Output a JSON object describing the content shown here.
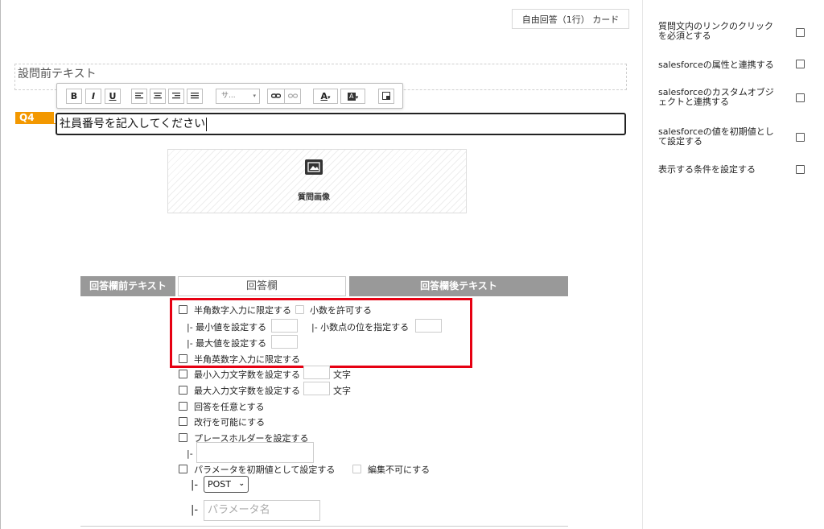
{
  "header": {
    "question_type": "自由回答（1行） カード"
  },
  "editor": {
    "pretext_label": "設問前テキスト",
    "toolbar": {
      "bold": "B",
      "italic": "I",
      "underline": "U",
      "font_size": "サ..."
    },
    "question_number": "Q4",
    "question_text": "社員番号を記入してください",
    "image_label": "質問画像"
  },
  "answer": {
    "pre_text_label": "回答欄前テキスト",
    "field_label": "回答欄",
    "post_text_label": "回答欄後テキスト"
  },
  "options": {
    "half_numeric": "半角数字入力に限定する",
    "allow_decimal": "小数を許可する",
    "min_value": "|- 最小値を設定する",
    "decimal_places": "|- 小数点の位を指定する",
    "max_value": "|- 最大値を設定する",
    "half_alnum": "半角英数字入力に限定する",
    "min_chars": "最小入力文字数を設定する",
    "min_chars_unit": "文字",
    "max_chars": "最大入力文字数を設定する",
    "max_chars_unit": "文字",
    "optional": "回答を任意とする",
    "allow_newline": "改行を可能にする",
    "placeholder": "プレースホルダーを設定する",
    "placeholder_prefix": "|-",
    "param_default": "パラメータを初期値として設定する",
    "not_editable": "編集不可にする",
    "method_prefix": "|-",
    "method_value": "POST",
    "param_prefix": "|-",
    "param_placeholder": "パラメータ名"
  },
  "sidebar": {
    "items": [
      {
        "label": "質問文内のリンクのクリックを必須とする"
      },
      {
        "label": "salesforceの属性と連携する"
      },
      {
        "label": "salesforceのカスタムオブジェクトと連携する"
      },
      {
        "label": "salesforceの値を初期値として設定する"
      },
      {
        "label": "表示する条件を設定する"
      }
    ]
  },
  "colors": {
    "accent": "#f39800",
    "highlight": "#e60012",
    "bar_gray": "#999999"
  }
}
